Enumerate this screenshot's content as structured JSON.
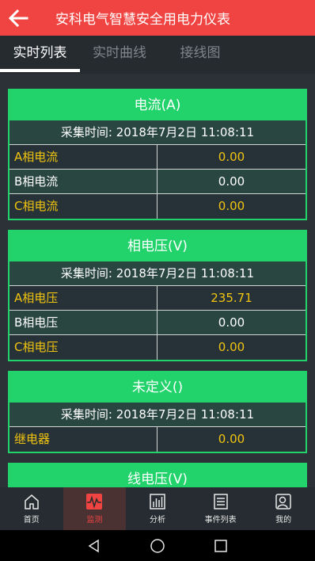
{
  "appbar": {
    "title": "安科电气智慧安全用电力仪表"
  },
  "tabs": [
    "实时列表",
    "实时曲线",
    "接线图"
  ],
  "cards": [
    {
      "title": "电流(A)",
      "time": "采集时间: 2018年7月2日 11:08:11",
      "rows": [
        {
          "name": "A相电流",
          "value": "0.00"
        },
        {
          "name": "B相电流",
          "value": "0.00"
        },
        {
          "name": "C相电流",
          "value": "0.00"
        }
      ]
    },
    {
      "title": "相电压(V)",
      "time": "采集时间: 2018年7月2日 11:08:11",
      "rows": [
        {
          "name": "A相电压",
          "value": "235.71"
        },
        {
          "name": "B相电压",
          "value": "0.00"
        },
        {
          "name": "C相电压",
          "value": "0.00"
        }
      ]
    },
    {
      "title": "未定义()",
      "time": "采集时间: 2018年7月2日 11:08:11",
      "rows": [
        {
          "name": "继电器",
          "value": "0.00"
        }
      ]
    },
    {
      "title": "线电压(V)"
    }
  ],
  "bottomnav": [
    {
      "label": "首页",
      "icon": "home-icon"
    },
    {
      "label": "监测",
      "icon": "monitor-icon"
    },
    {
      "label": "分析",
      "icon": "analysis-icon"
    },
    {
      "label": "事件列表",
      "icon": "event-list-icon"
    },
    {
      "label": "我的",
      "icon": "profile-icon"
    }
  ],
  "colors": {
    "primary": "#f04442",
    "accent_green": "#22d36b",
    "value_yellow": "#f1c40f"
  }
}
